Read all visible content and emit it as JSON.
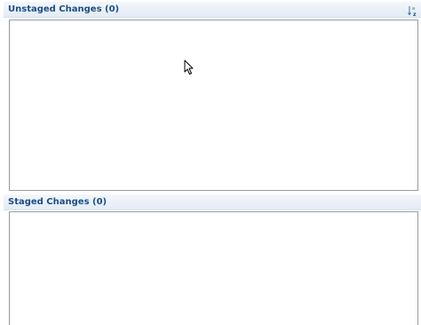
{
  "unstaged": {
    "title": "Unstaged Changes (0)",
    "count": 0,
    "sort_icon": "sort-alpha-icon"
  },
  "staged": {
    "title": "Staged Changes (0)",
    "count": 0
  },
  "cursor_icon": "mouse-pointer-icon"
}
